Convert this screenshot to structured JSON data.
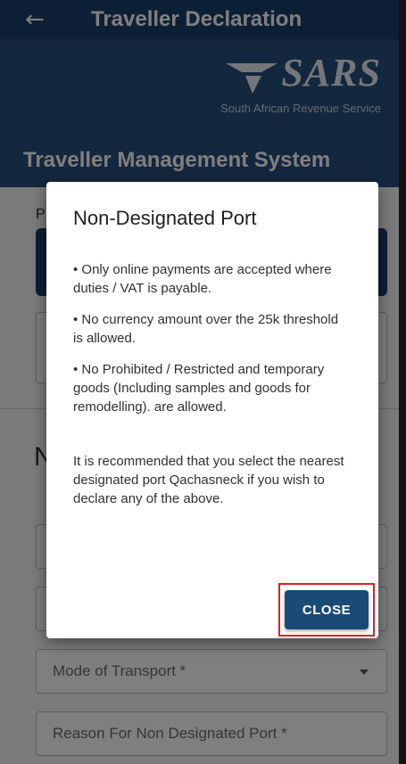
{
  "appbar": {
    "back_icon": "arrow-left-icon",
    "title": "Traveller Declaration"
  },
  "banner": {
    "logo_text": "SARS",
    "logo_subtitle": "South African Revenue Service",
    "system_title": "Traveller Management System"
  },
  "background": {
    "partial_label": "P",
    "partial_heading": "N",
    "fields": [
      {
        "label": "Mode of Transport *",
        "type": "select"
      },
      {
        "label": "Reason For Non Designated Port *",
        "type": "text"
      }
    ]
  },
  "dialog": {
    "title": "Non-Designated Port",
    "bullets": [
      "• Only online payments are accepted where duties / VAT is payable.",
      "• No currency amount over the 25k threshold is allowed.",
      "• No Prohibited / Restricted and temporary goods (Including samples and goods for remodelling). are allowed."
    ],
    "recommendation": "It is recommended that you select the nearest designated port Qachasneck if you wish to declare any of the above.",
    "close_label": "CLOSE"
  },
  "colors": {
    "appbar": "#1a3e68",
    "banner": "#264f7c",
    "button": "#1a4a76",
    "highlight": "#e21c22"
  }
}
